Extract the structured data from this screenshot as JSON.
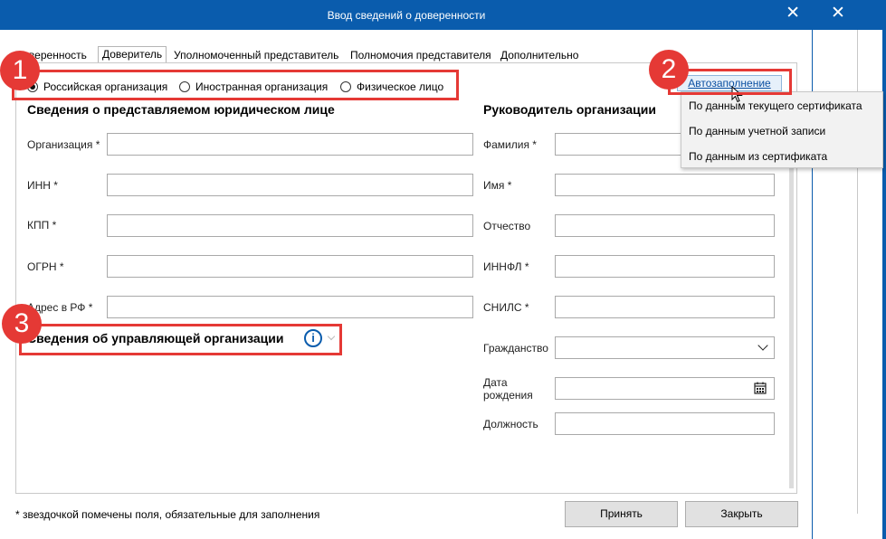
{
  "window": {
    "title": "Ввод сведений о доверенности",
    "close_glyph": "✕"
  },
  "tabs": [
    {
      "label": "Доверенность"
    },
    {
      "label": "Доверитель"
    },
    {
      "label": "Уполномоченный представитель"
    },
    {
      "label": "Полномочия представителя"
    },
    {
      "label": "Дополнительно"
    }
  ],
  "entity_type": {
    "options": [
      "Российская организация",
      "Иностранная организация",
      "Физическое лицо"
    ],
    "selected": "Российская организация"
  },
  "left_section": {
    "heading": "Сведения о представляемом юридическом лице",
    "fields": [
      {
        "label": "Организация *",
        "value": ""
      },
      {
        "label": "ИНН *",
        "value": ""
      },
      {
        "label": "КПП *",
        "value": ""
      },
      {
        "label": "ОГРН *",
        "value": ""
      },
      {
        "label": "Адрес в РФ *",
        "value": ""
      }
    ],
    "managing_org_heading": "Сведения об управляющей организации"
  },
  "right_section": {
    "heading": "Руководитель организации",
    "fields": [
      {
        "label": "Фамилия *",
        "value": ""
      },
      {
        "label": "Имя *",
        "value": ""
      },
      {
        "label": "Отчество",
        "value": ""
      },
      {
        "label": "ИННФЛ *",
        "value": ""
      },
      {
        "label": "СНИЛС *",
        "value": ""
      },
      {
        "label": "Гражданство",
        "value": ""
      },
      {
        "label": "Дата рождения",
        "value": ""
      },
      {
        "label": "Должность",
        "value": ""
      }
    ]
  },
  "autofill": {
    "button_label": "Автозаполнение",
    "menu_items": [
      "По данным текущего сертификата",
      "По данным учетной записи",
      "По данным из сертификата"
    ]
  },
  "footer": {
    "note": "* звездочкой помечены поля, обязательные для заполнения",
    "accept_label": "Принять",
    "close_label": "Закрыть"
  },
  "annotations": {
    "labels": [
      "1",
      "2",
      "3"
    ],
    "color": "#e53935"
  },
  "colors": {
    "accent": "#0a5cad"
  }
}
